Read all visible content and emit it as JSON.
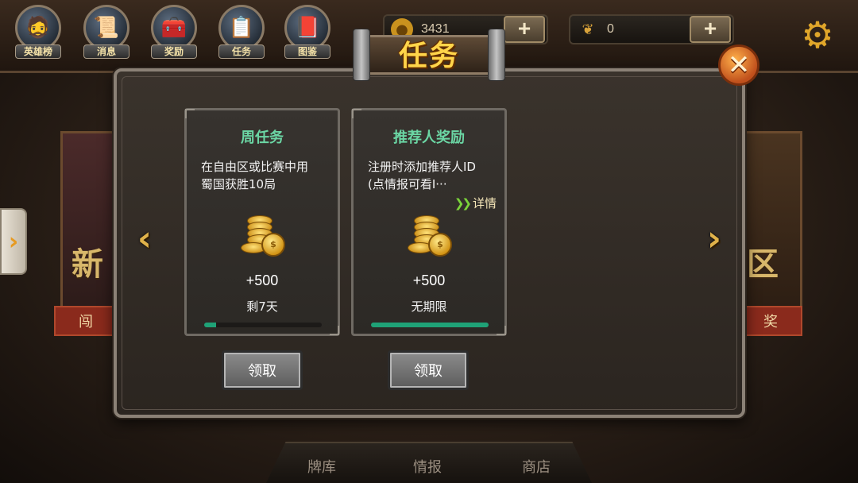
{
  "nav": {
    "items": [
      {
        "label": "英雄榜",
        "icon": "hero-portrait"
      },
      {
        "label": "消息",
        "icon": "scroll-icon"
      },
      {
        "label": "奖励",
        "icon": "chest-icon"
      },
      {
        "label": "任务",
        "icon": "quest-icon"
      },
      {
        "label": "图鉴",
        "icon": "book-icon"
      }
    ]
  },
  "currency": {
    "gold": {
      "value": "3431",
      "icon": "gold-coin-icon",
      "add_label": "+"
    },
    "wheat": {
      "value": "0",
      "icon": "wheat-icon",
      "add_label": "+"
    }
  },
  "dialog": {
    "title": "任务",
    "close_label": "✕",
    "left_arrow": "‹",
    "right_arrow": "›"
  },
  "side_tab": {
    "label": "›"
  },
  "background": {
    "left_title": "新",
    "left_banner": "闯",
    "right_title": "区",
    "right_banner": "奖"
  },
  "quests": [
    {
      "title": "周任务",
      "desc_line1": "在自由区或比赛中用",
      "desc_line2": "蜀国获胜10局",
      "reward": "+500",
      "time": "剩7天",
      "progress": 0.1,
      "claim_label": "领取"
    },
    {
      "title": "推荐人奖励",
      "desc_line1": "注册时添加推荐人ID",
      "desc_line2": "(点情报可看I···",
      "detail_label": "详情",
      "reward": "+500",
      "time": "无期限",
      "progress": 1.0,
      "claim_label": "领取"
    }
  ],
  "bottom_nav": {
    "items": [
      "牌库",
      "情报",
      "商店"
    ]
  },
  "colors": {
    "accent_gold": "#ffd54a",
    "quest_title_green": "#6bd6a4",
    "progress_green": "#1fa277"
  }
}
